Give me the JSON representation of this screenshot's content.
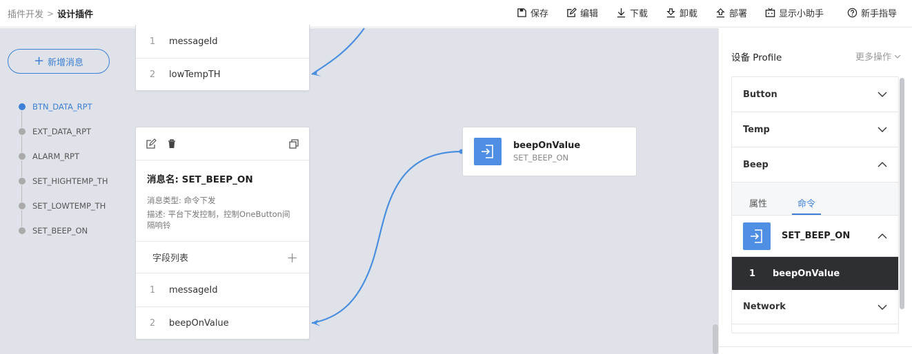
{
  "breadcrumb": {
    "parent": "插件开发",
    "separator": ">",
    "current": "设计插件"
  },
  "toolbar": {
    "save": "保存",
    "edit": "编辑",
    "download": "下载",
    "uninstall": "卸载",
    "deploy": "部署",
    "assistant": "显示小助手",
    "guide": "新手指导"
  },
  "sidebar": {
    "add_button": "新增消息",
    "messages": [
      {
        "label": "BTN_DATA_RPT",
        "active": true
      },
      {
        "label": "EXT_DATA_RPT",
        "active": false
      },
      {
        "label": "ALARM_RPT",
        "active": false
      },
      {
        "label": "SET_HIGHTEMP_TH",
        "active": false
      },
      {
        "label": "SET_LOWTEMP_TH",
        "active": false
      },
      {
        "label": "SET_BEEP_ON",
        "active": false
      }
    ]
  },
  "top_card": {
    "fields": [
      {
        "index": "1",
        "name": "messageId"
      },
      {
        "index": "2",
        "name": "lowTempTH"
      }
    ]
  },
  "message_card": {
    "title": "消息名: SET_BEEP_ON",
    "type_line": "消息类型: 命令下发",
    "desc_line1": "描述: 平台下发控制，控制OneButton间",
    "desc_line2": "隔响铃",
    "field_list_label": "字段列表",
    "fields": [
      {
        "index": "1",
        "name": "messageId"
      },
      {
        "index": "2",
        "name": "beepOnValue"
      }
    ]
  },
  "command_node": {
    "title": "beepOnValue",
    "subtitle": "SET_BEEP_ON"
  },
  "right_panel": {
    "title": "设备 Profile",
    "more_actions": "更多操作",
    "sections": [
      {
        "name": "Button",
        "expanded": false
      },
      {
        "name": "Temp",
        "expanded": false
      },
      {
        "name": "Beep",
        "expanded": true
      }
    ],
    "tabs": {
      "properties": "属性",
      "commands": "命令"
    },
    "command": {
      "name": "SET_BEEP_ON",
      "field_index": "1",
      "field_name": "beepOnValue"
    },
    "network": "Network"
  },
  "colors": {
    "accent": "#3d7fd6",
    "canvas": "#dfe2e8",
    "node_icon": "#4f8fe3",
    "dark_row": "#2d2f33"
  },
  "icons": [
    "save-icon",
    "edit-icon",
    "download-icon",
    "uninstall-icon",
    "deploy-icon",
    "assistant-icon",
    "help-icon",
    "delete-icon",
    "copy-icon",
    "arrow-in-icon",
    "chevron-down-icon",
    "chevron-up-icon",
    "plus-icon"
  ]
}
